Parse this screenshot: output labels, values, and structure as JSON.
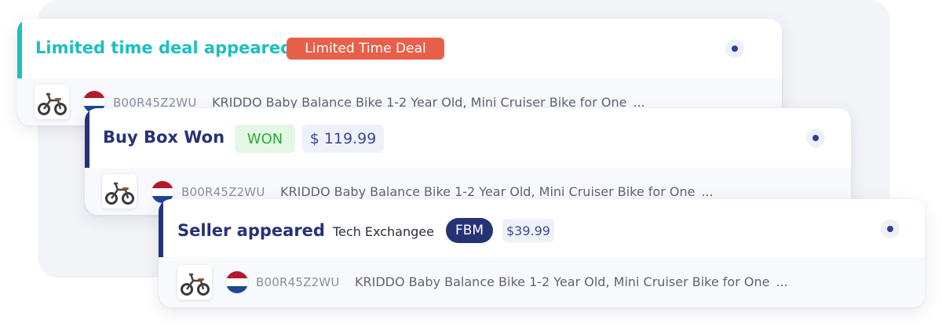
{
  "colors": {
    "teal": "#1bbfc1",
    "navy": "#263276",
    "deal_badge": "#e9604a",
    "won_bg": "#e4f7e4",
    "won_text": "#2bab37",
    "price_bg": "#eef1fa",
    "price_text": "#3d4a8a"
  },
  "cards": [
    {
      "title": "Limited time deal appeared",
      "badge": "Limited Time Deal",
      "product": {
        "asin": "B00R45Z2WU",
        "title": "KRIDDO Baby Balance Bike 1-2 Year Old, Mini Cruiser Bike for One",
        "ellipsis": "..."
      }
    },
    {
      "title": "Buy Box Won",
      "status": "WON",
      "price": "$ 119.99",
      "product": {
        "asin": "B00R45Z2WU",
        "title": "KRIDDO Baby Balance Bike 1-2 Year Old, Mini Cruiser Bike for One",
        "ellipsis": "..."
      }
    },
    {
      "title": "Seller appeared",
      "seller": "Tech Exchangee",
      "fulfillment": "FBM",
      "price": "$39.99",
      "product": {
        "asin": "B00R45Z2WU",
        "title": "KRIDDO Baby Balance Bike 1-2 Year Old, Mini Cruiser Bike for One",
        "ellipsis": "..."
      }
    }
  ],
  "icons": {
    "thumbnail": "balance-bike-thumbnail",
    "flag": "netherlands-flag-icon",
    "menu": "dot-menu-icon"
  }
}
